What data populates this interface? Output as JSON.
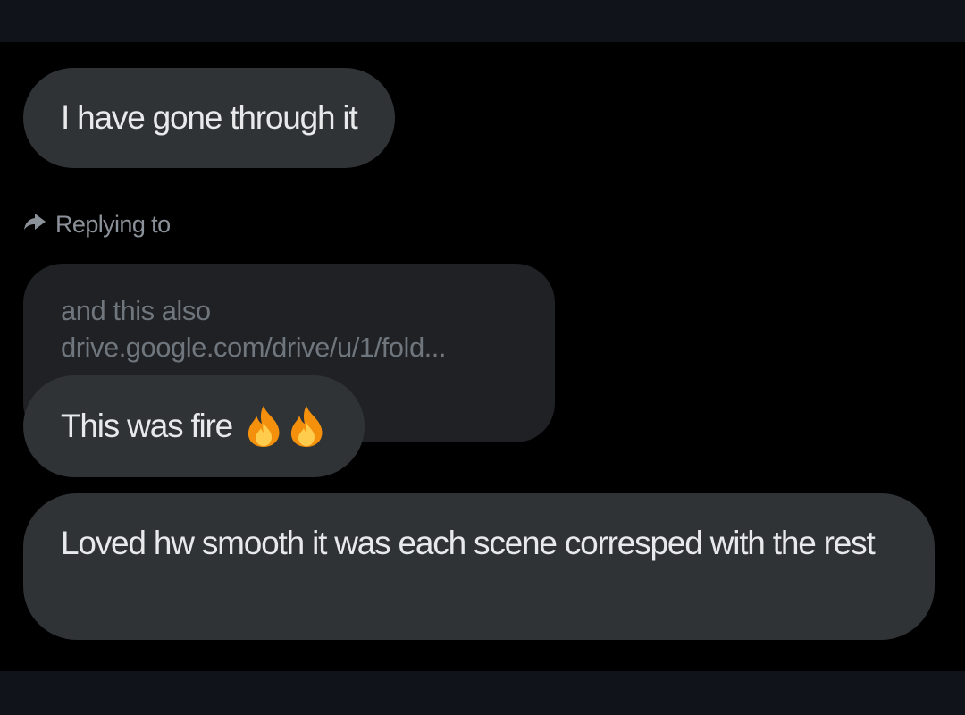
{
  "messages": [
    {
      "text": "I have gone through it"
    },
    {
      "text": "This was fire",
      "emoji": [
        "fire-emoji",
        "fire-emoji"
      ]
    },
    {
      "text": "Loved hw smooth it was each scene corresped with the rest"
    }
  ],
  "reply": {
    "label": "Replying to",
    "icon": "reply-arrow-icon",
    "quoted_lines": [
      "and this also",
      "drive.google.com/drive/u/1/fold..."
    ]
  },
  "colors": {
    "background": "#000000",
    "bars": "#10141a",
    "bubble": "#2f3336",
    "quoted_bubble": "#1f2124",
    "text": "#e7e9ea",
    "muted_text": "#8b9198"
  }
}
